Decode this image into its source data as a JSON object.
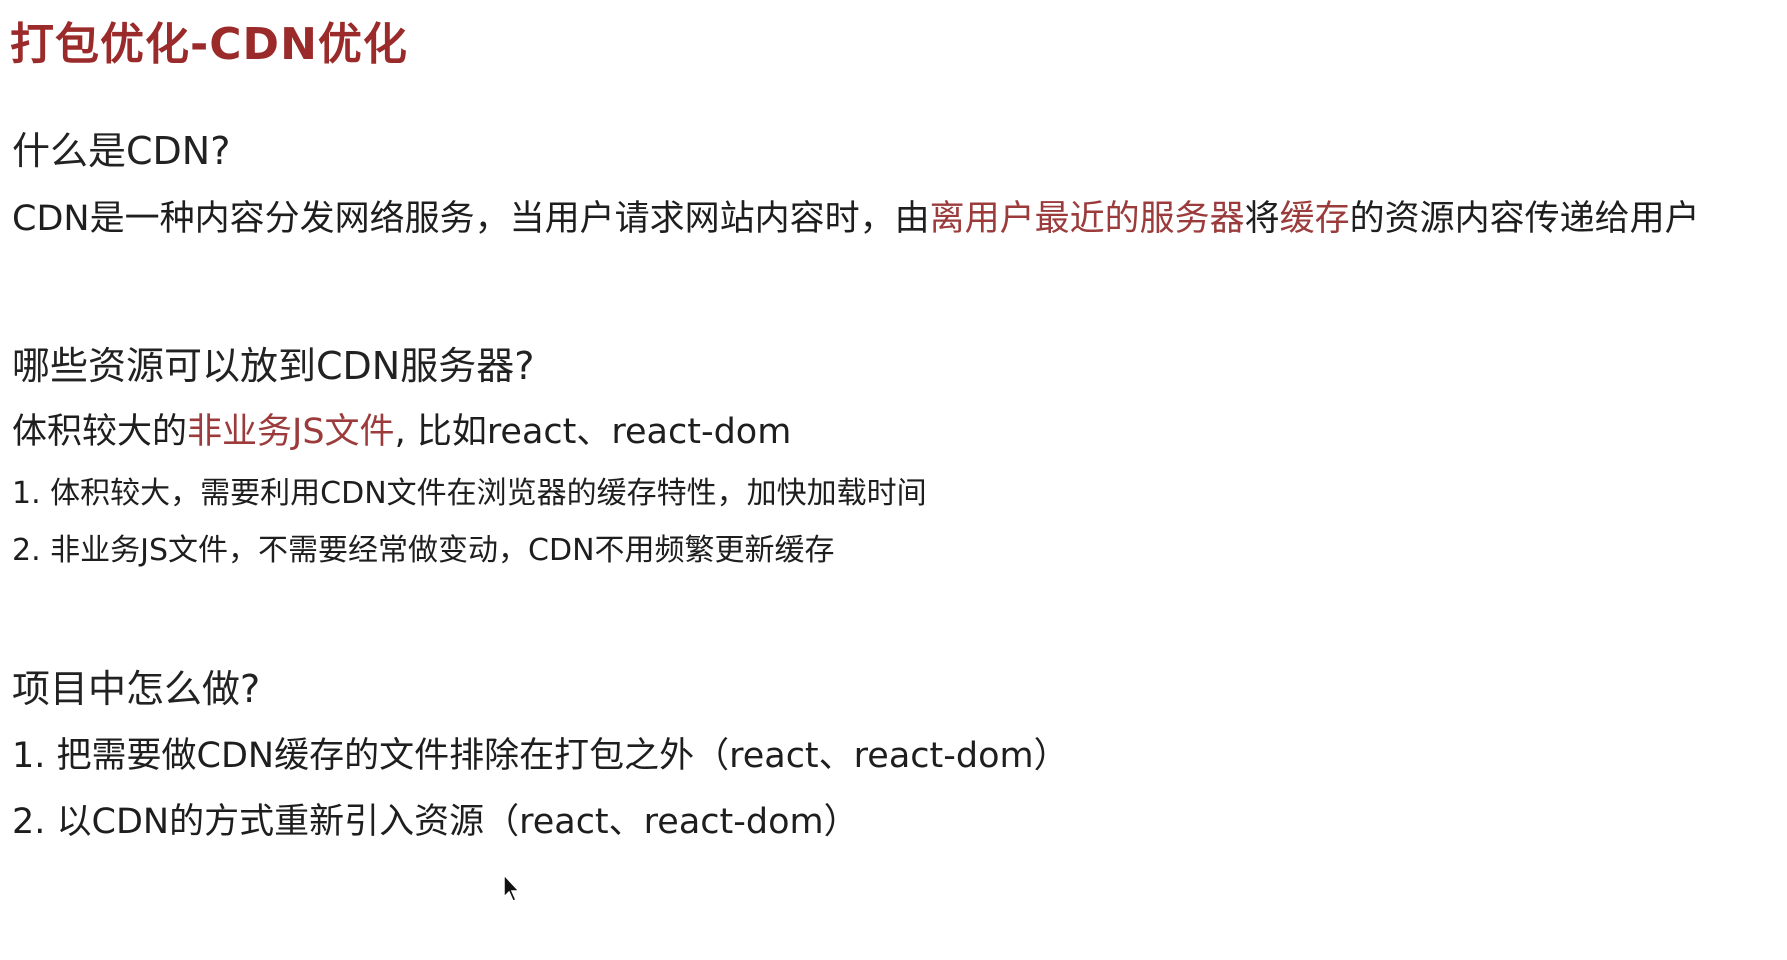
{
  "title": "打包优化-CDN优化",
  "section1": {
    "question": "什么是CDN?",
    "answer_parts": {
      "p1": "CDN是一种内容分发网络服务，当用户请求网站内容时，由",
      "hl1": "离用户最近的服务器",
      "p2": "将",
      "hl2": "缓存",
      "p3": "的资源内容传递给用户"
    }
  },
  "section2": {
    "question": "哪些资源可以放到CDN服务器?",
    "intro_parts": {
      "p1": "体积较大的",
      "hl1": "非业务JS文件",
      "p2": ", 比如react、react-dom"
    },
    "points": [
      "1. 体积较大，需要利用CDN文件在浏览器的缓存特性，加快加载时间",
      "2. 非业务JS文件，不需要经常做变动，CDN不用频繁更新缓存"
    ]
  },
  "section3": {
    "question": "项目中怎么做?",
    "steps": [
      "1. 把需要做CDN缓存的文件排除在打包之外（react、react-dom）",
      "2. 以CDN的方式重新引入资源（react、react-dom）"
    ]
  },
  "colors": {
    "title": "#9b2a2a",
    "highlight": "#9b3b3b",
    "text": "#1e1e1e"
  },
  "icons": {
    "cursor": "mouse-pointer-icon"
  }
}
